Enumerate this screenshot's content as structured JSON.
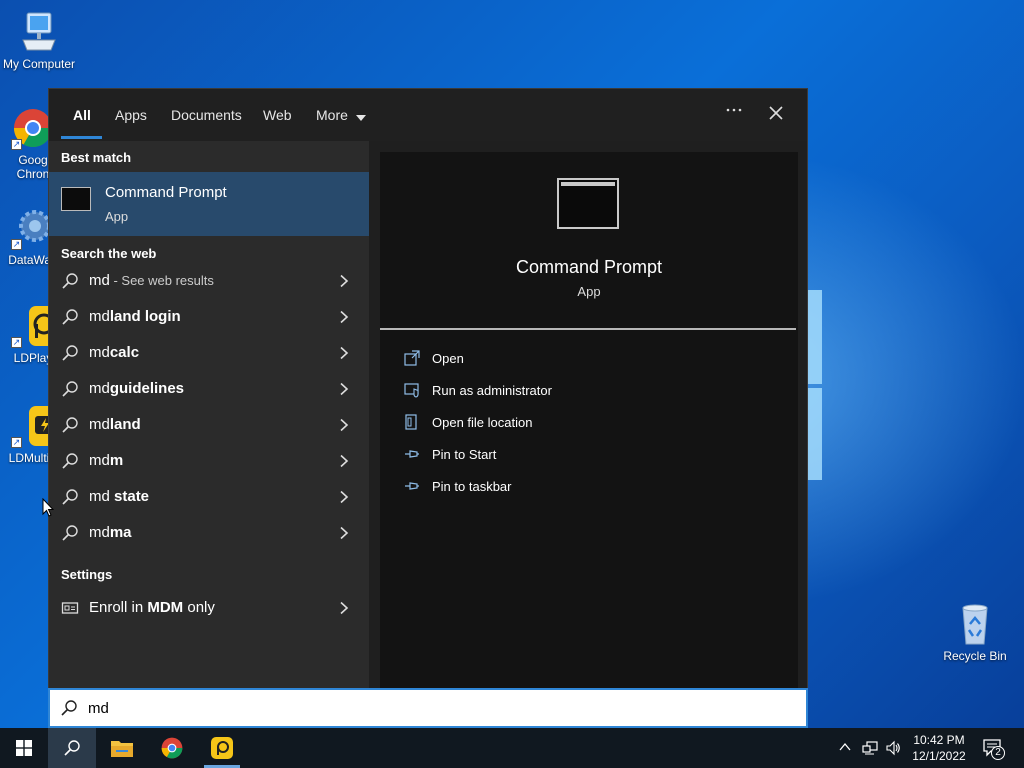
{
  "desktop": {
    "icons": [
      {
        "label": "My Computer"
      },
      {
        "label": "Goog\nChron"
      },
      {
        "label": "DataWag"
      },
      {
        "label": "LDPlay"
      },
      {
        "label": "LDMultiP"
      },
      {
        "label": "Recycle Bin"
      }
    ]
  },
  "search_panel": {
    "tabs": [
      {
        "label": "All",
        "active": true
      },
      {
        "label": "Apps"
      },
      {
        "label": "Documents"
      },
      {
        "label": "Web"
      },
      {
        "label": "More"
      }
    ],
    "more_icon": "ellipsis-icon",
    "close_icon": "close-icon",
    "best_match": {
      "section_label": "Best match",
      "name": "Command Prompt",
      "type": "App"
    },
    "web": {
      "section_label": "Search the web",
      "results": [
        {
          "prefix": "md",
          "bold": "",
          "hint": " - See web results"
        },
        {
          "prefix": "md",
          "bold": "land login",
          "hint": ""
        },
        {
          "prefix": "md",
          "bold": "calc",
          "hint": ""
        },
        {
          "prefix": "md",
          "bold": "guidelines",
          "hint": ""
        },
        {
          "prefix": "md",
          "bold": "land",
          "hint": ""
        },
        {
          "prefix": "md",
          "bold": "m",
          "hint": ""
        },
        {
          "prefix": "md",
          "bold": " state",
          "hint": ""
        },
        {
          "prefix": "md",
          "bold": "ma",
          "hint": ""
        }
      ]
    },
    "settings": {
      "section_label": "Settings",
      "items": [
        {
          "pre": "Enroll in ",
          "bold": "MDM",
          "post": " only"
        }
      ]
    },
    "preview": {
      "name": "Command Prompt",
      "type": "App",
      "actions": [
        {
          "label": "Open",
          "icon": "open-icon"
        },
        {
          "label": "Run as administrator",
          "icon": "shield-icon"
        },
        {
          "label": "Open file location",
          "icon": "file-location-icon"
        },
        {
          "label": "Pin to Start",
          "icon": "pin-icon"
        },
        {
          "label": "Pin to taskbar",
          "icon": "pin-icon"
        }
      ]
    },
    "search_box": {
      "value": "md"
    }
  },
  "taskbar": {
    "time": "10:42 PM",
    "date": "12/1/2022",
    "notification_count": "2"
  },
  "colors": {
    "accent": "#2f86d6",
    "selected_row": "#284a6c",
    "panel_dark": "#1f1f1f",
    "left_list": "#2b2b2b",
    "preview_bg": "#131313"
  }
}
